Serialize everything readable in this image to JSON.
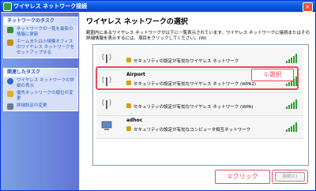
{
  "window": {
    "title": "ワイヤレス ネットワーク接続"
  },
  "sidebar": {
    "network_tasks_title": "ネットワークのタスク",
    "network_tasks": [
      {
        "label": "ネットワークの一覧を最新の情報に更新"
      },
      {
        "label": "ホームまたは小規模オフィスのワイヤレス ネットワークをセットアップする"
      }
    ],
    "related_tasks_title": "関連したタスク",
    "related_tasks": [
      {
        "label": "ワイヤレス ネットワークの詳細の表示"
      },
      {
        "label": "優先ネットワークの順位の変更"
      },
      {
        "label": "詳細設定の変更"
      }
    ]
  },
  "main": {
    "title": "ワイヤレス ネットワークの選択",
    "description": "範囲内にあるワイヤレス ネットワークが以下に一覧表示されています。ワイヤレス ネットワークに接続またはその詳細情報を表示するには、項目をクリックしてください。(W)"
  },
  "networks": [
    {
      "name": "",
      "security": "セキュリティの設定が有効なワイヤレス ネットワーク"
    },
    {
      "name": "Airport",
      "security": "セキュリティの設定が有効なワイヤレス ネットワーク (WPA2)"
    },
    {
      "name": "",
      "security": "セキュリティの設定が有効なワイヤレス ネットワーク (WPA)"
    },
    {
      "name": "adhoc",
      "security": "セキュリティの設定が有効なコンピュータ相互ネットワーク"
    }
  ],
  "annotations": {
    "select_label": "①選択",
    "click_label": "②クリック"
  },
  "buttons": {
    "connect_label": "接続(C)"
  },
  "colors": {
    "accent": "#e84a5f",
    "titlebar": "#0a58e0"
  }
}
